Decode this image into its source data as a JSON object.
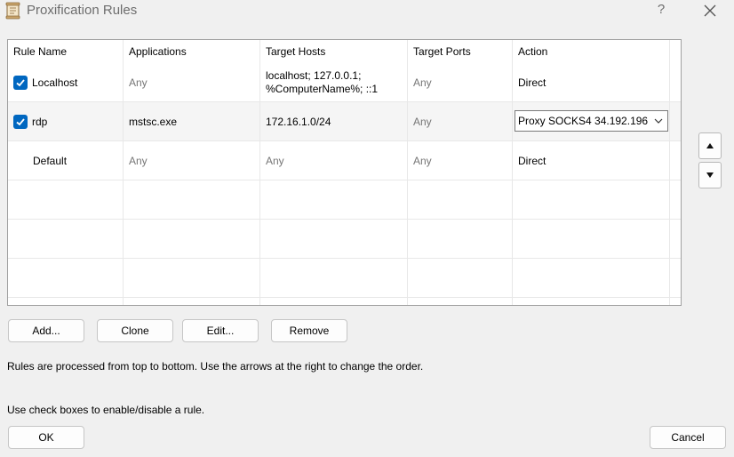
{
  "window": {
    "title": "Proxification Rules",
    "help": "?",
    "app_icon": "proxifier-scroll-icon",
    "close_icon": "close-icon"
  },
  "table": {
    "headers": [
      "Rule Name",
      "Applications",
      "Target Hosts",
      "Target Ports",
      "Action"
    ],
    "rows": [
      {
        "checked": true,
        "name": "Localhost",
        "applications": "Any",
        "hosts_line1": "localhost; 127.0.0.1;",
        "hosts_line2": "%ComputerName%; ::1",
        "ports": "Any",
        "action": "Direct"
      },
      {
        "checked": true,
        "name": "rdp",
        "applications": "mstsc.exe",
        "hosts": "172.16.1.0/24",
        "ports": "Any",
        "action": "Proxy SOCKS4 34.192.196"
      },
      {
        "checked": false,
        "name": "Default",
        "applications": "Any",
        "hosts": "Any",
        "ports": "Any",
        "action": "Direct"
      }
    ]
  },
  "buttons": {
    "add": "Add...",
    "clone": "Clone",
    "edit": "Edit...",
    "remove": "Remove",
    "ok": "OK",
    "cancel": "Cancel"
  },
  "info": {
    "line1": "Rules are processed from top to bottom. Use the arrows at the right to change the order.",
    "line2": "Use check boxes to enable/disable a rule."
  },
  "colors": {
    "accent": "#0067c0",
    "background": "#f0f0f0"
  }
}
